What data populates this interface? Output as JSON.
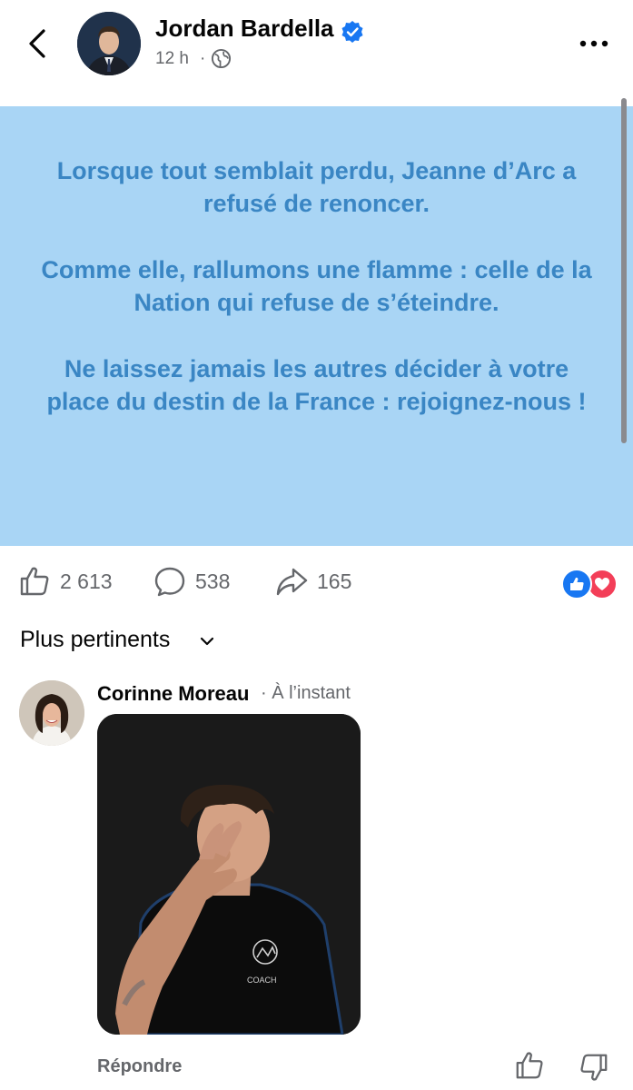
{
  "header": {
    "author_name": "Jordan Bardella",
    "post_time": "12 h",
    "separator": "·",
    "back_icon": "chevron-left-icon",
    "verified_icon": "verified-badge-icon",
    "audience_icon": "globe-icon",
    "more_icon": "more-horizontal-icon"
  },
  "post": {
    "background_color": "#a9d5f5",
    "text_color": "#3a86c4",
    "paragraphs": [
      "Lorsque tout semblait perdu, Jeanne d’Arc a refusé de renoncer.",
      "Comme elle, rallumons une flamme : celle de la Nation qui refuse de s’éteindre.",
      "Ne laissez jamais les autres décider à votre place du destin de la France : rejoignez-nous !"
    ]
  },
  "stats": {
    "likes": "2 613",
    "comments": "538",
    "shares": "165",
    "reactions": [
      "like",
      "love"
    ]
  },
  "comments_sort": {
    "label": "Plus pertinents"
  },
  "comment": {
    "author": "Corinne Moreau",
    "time": "· À l’instant",
    "reply_label": "Répondre",
    "gif_shirt_text": "COACH"
  }
}
